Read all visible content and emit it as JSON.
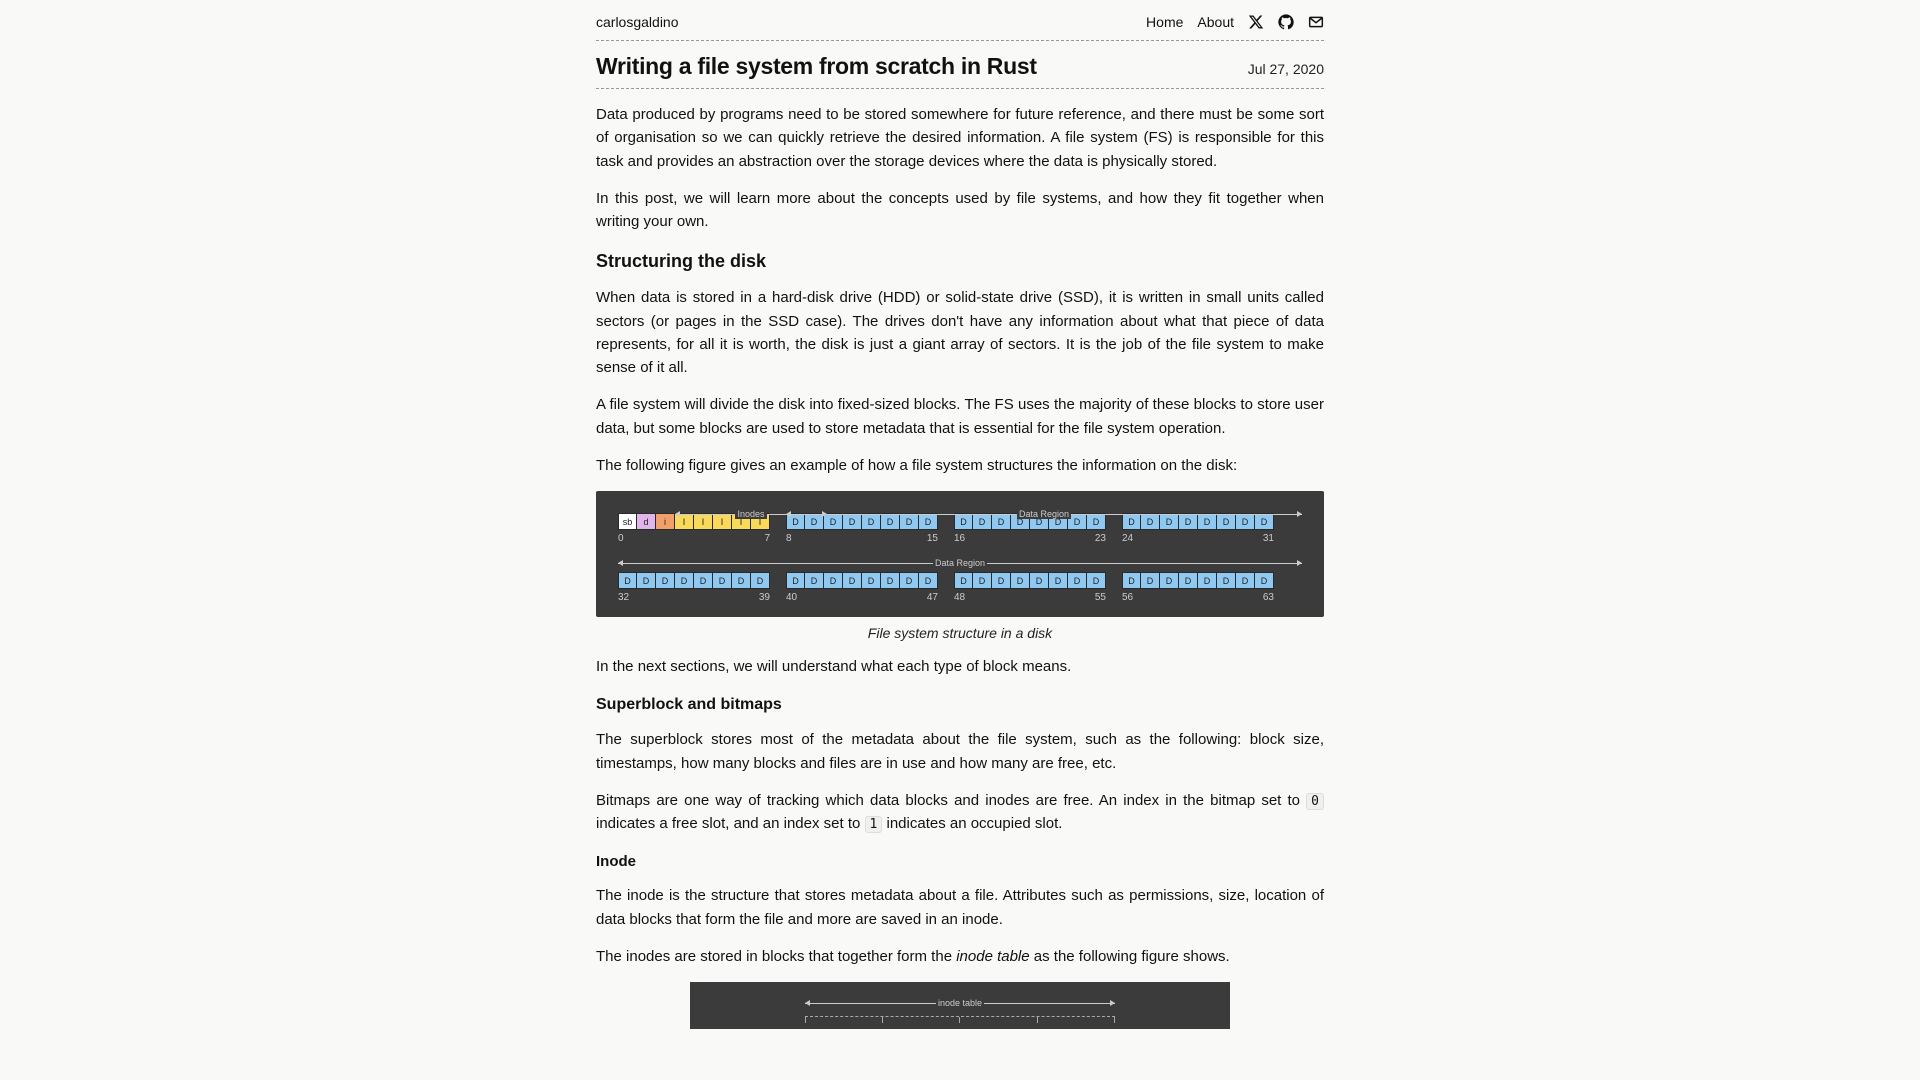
{
  "site": {
    "name": "carlosgaldino"
  },
  "nav": {
    "home": "Home",
    "about": "About"
  },
  "article": {
    "title": "Writing a file system from scratch in Rust",
    "date": "Jul 27, 2020",
    "p1": "Data produced by programs need to be stored somewhere for future reference, and there must be some sort of organisation so we can quickly retrieve the desired information. A file system (FS) is responsible for this task and provides an abstraction over the storage devices where the data is physically stored.",
    "p2": "In this post, we will learn more about the concepts used by file systems, and how they fit together when writing your own.",
    "h2a": "Structuring the disk",
    "p3": "When data is stored in a hard-disk drive (HDD) or solid-state drive (SSD), it is written in small units called sectors (or pages in the SSD case). The drives don't have any information about what that piece of data represents, for all it is worth, the disk is just a giant array of sectors. It is the job of the file system to make sense of it all.",
    "p4": "A file system will divide the disk into fixed-sized blocks. The FS uses the majority of these blocks to store user data, but some blocks are used to store metadata that is essential for the file system operation.",
    "p5": "The following figure gives an example of how a file system structures the information on the disk:",
    "fig1": {
      "caption": "File system structure in a disk",
      "label_inodes": "Inodes",
      "label_data": "Data Region",
      "row1_nums": [
        [
          "0",
          "7"
        ],
        [
          "8",
          "15"
        ],
        [
          "16",
          "23"
        ],
        [
          "24",
          "31"
        ]
      ],
      "row2_nums": [
        [
          "32",
          "39"
        ],
        [
          "40",
          "47"
        ],
        [
          "48",
          "55"
        ],
        [
          "56",
          "63"
        ]
      ]
    },
    "p6": "In the next sections, we will understand what each type of block means.",
    "h3a": "Superblock and bitmaps",
    "p7": "The superblock stores most of the metadata about the file system, such as the following: block size, timestamps, how many blocks and files are in use and how many are free, etc.",
    "p8a": "Bitmaps are one way of tracking which data blocks and inodes are free. An index in the bitmap set to ",
    "p8code0": "0",
    "p8b": " indicates a free slot, and an index set to ",
    "p8code1": "1",
    "p8c": " indicates an occupied slot.",
    "h4a": "Inode",
    "p9": "The inode is the structure that stores metadata about a file. Attributes such as permissions, size, location of data blocks that form the file and more are saved in an inode.",
    "p10a": "The inodes are stored in blocks that together form the ",
    "p10em": "inode table",
    "p10b": " as the following figure shows.",
    "fig2": {
      "label": "inode table"
    }
  }
}
